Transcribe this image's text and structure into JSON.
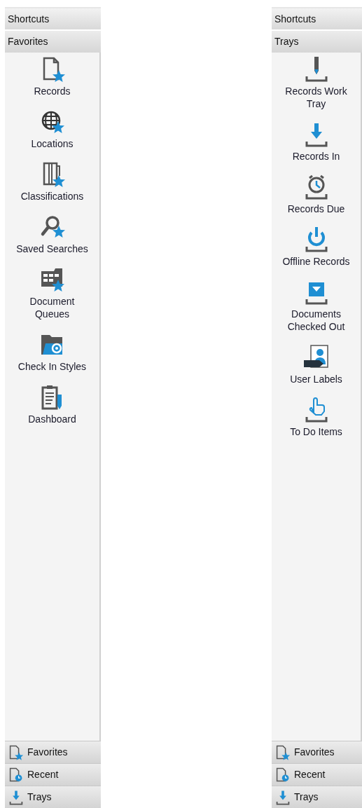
{
  "panels": [
    {
      "header": "Shortcuts",
      "group": "Favorites",
      "items": [
        {
          "label": "Records",
          "kind": "records"
        },
        {
          "label": "Locations",
          "kind": "locations"
        },
        {
          "label": "Classifications",
          "kind": "classifications"
        },
        {
          "label": "Saved Searches",
          "kind": "searches"
        },
        {
          "label": "Document Queues",
          "kind": "queues"
        },
        {
          "label": "Check In Styles",
          "kind": "checkin"
        },
        {
          "label": "Dashboard",
          "kind": "dashboard"
        }
      ],
      "nav": [
        {
          "label": "Favorites",
          "kind": "favorites"
        },
        {
          "label": "Recent",
          "kind": "recent"
        },
        {
          "label": "Trays",
          "kind": "trays"
        }
      ]
    },
    {
      "header": "Shortcuts",
      "group": "Trays",
      "items": [
        {
          "label": "Records Work Tray",
          "kind": "worktray"
        },
        {
          "label": "Records In",
          "kind": "in"
        },
        {
          "label": "Records Due",
          "kind": "due"
        },
        {
          "label": "Offline Records",
          "kind": "offline"
        },
        {
          "label": "Documents Checked Out",
          "kind": "checkedout"
        },
        {
          "label": "User Labels",
          "kind": "labels"
        },
        {
          "label": "To Do Items",
          "kind": "todo"
        }
      ],
      "nav": [
        {
          "label": "Favorites",
          "kind": "favorites"
        },
        {
          "label": "Recent",
          "kind": "recent"
        },
        {
          "label": "Trays",
          "kind": "trays"
        }
      ]
    }
  ]
}
